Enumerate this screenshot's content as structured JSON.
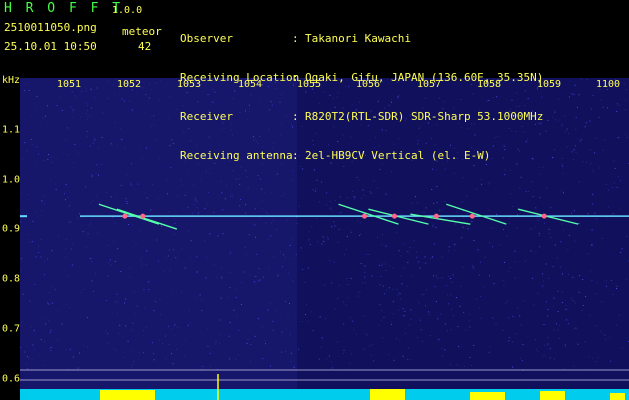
{
  "app": {
    "title": "H R O F F T",
    "version": "1.0.0",
    "file_name": "2510011050.png",
    "timestamp": "25.10.01 10:50",
    "meteor_label": "meteor",
    "meteor_count": "42"
  },
  "station": [
    {
      "label": "Observer",
      "value": "Takanori Kawachi"
    },
    {
      "label": "Receiving Location",
      "value": "Ogaki, Gifu, JAPAN (136.60E, 35.35N)"
    },
    {
      "label": "Receiver",
      "value": "R820T2(RTL-SDR) SDR-Sharp 53.1000MHz"
    },
    {
      "label": "Receiving antenna",
      "value": "2el-HB9CV Vertical (el. E-W)"
    }
  ],
  "colors": {
    "text": "#ffff55",
    "title": "#44ff44",
    "background_noise": "#16166a",
    "carrier": "#66ddff",
    "echo": "#55ffaa",
    "hot": "#ff6688",
    "bottom_bar": "#00ccee",
    "peaks": "#ffff00"
  },
  "chart_data": {
    "type": "heatmap",
    "x_unit": "time (HHMM)",
    "xlabel": "",
    "ylabel": "kHz",
    "x_ticks": [
      "1051",
      "1052",
      "1053",
      "1054",
      "1055",
      "1056",
      "1057",
      "1058",
      "1059",
      "1100"
    ],
    "y_ticks": [
      "1.1",
      "1.0",
      "0.9",
      "0.8",
      "0.7",
      "0.6"
    ],
    "ylim": [
      0.57,
      1.18
    ],
    "carrier_frequency_khz": 0.906,
    "meteor_echoes": [
      {
        "time": "1052.0",
        "freq_start": 0.93,
        "freq_end": 0.89
      },
      {
        "time": "1052.3",
        "freq_start": 0.92,
        "freq_end": 0.88
      },
      {
        "time": "1056.0",
        "freq_start": 0.93,
        "freq_end": 0.89
      },
      {
        "time": "1056.5",
        "freq_start": 0.92,
        "freq_end": 0.89
      },
      {
        "time": "1057.2",
        "freq_start": 0.91,
        "freq_end": 0.89
      },
      {
        "time": "1057.8",
        "freq_start": 0.93,
        "freq_end": 0.89
      },
      {
        "time": "1059.0",
        "freq_start": 0.92,
        "freq_end": 0.89
      }
    ]
  }
}
